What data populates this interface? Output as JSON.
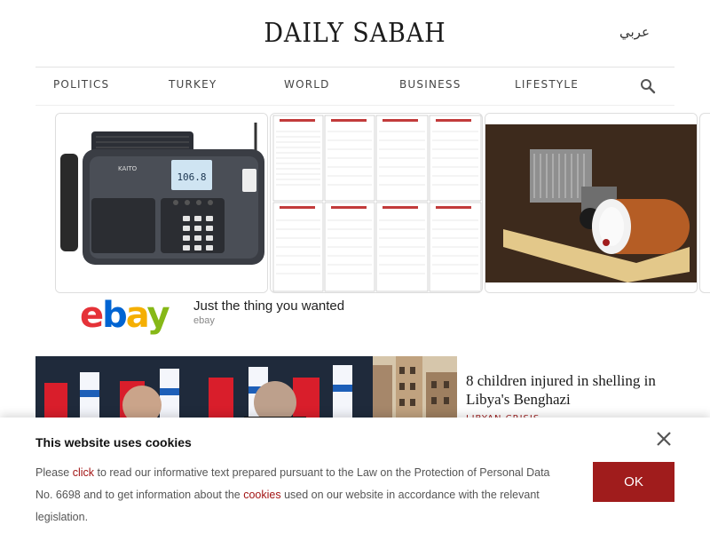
{
  "header": {
    "logo": "DAILY SABAH",
    "lang_link": "عربي"
  },
  "nav": {
    "items": [
      "POLITICS",
      "TURKEY",
      "WORLD",
      "BUSINESS",
      "LIFESTYLE"
    ],
    "search_icon": "search-icon"
  },
  "ad": {
    "headline": "Just the thing you wanted",
    "source": "ebay",
    "logo_letters": [
      "e",
      "b",
      "a",
      "y"
    ],
    "logo_colors": [
      "#e53238",
      "#0064d2",
      "#f5af02",
      "#86b817"
    ],
    "radio_display": "106.8"
  },
  "news": {
    "headline": "8 children injured in shelling in Libya's Benghazi",
    "kicker": "LIBYAN CRISIS"
  },
  "cookie": {
    "title": "This website uses cookies",
    "text_1": "Please ",
    "link_1": "click",
    "text_2": " to read our informative text prepared pursuant to the Law on the Protection of Personal Data No. 6698 and to get information about the ",
    "link_2": "cookies",
    "text_3": " used on our website in accordance with the relevant legislation.",
    "ok_label": "OK"
  },
  "colors": {
    "accent": "#a01c1c",
    "link": "#a31515"
  }
}
